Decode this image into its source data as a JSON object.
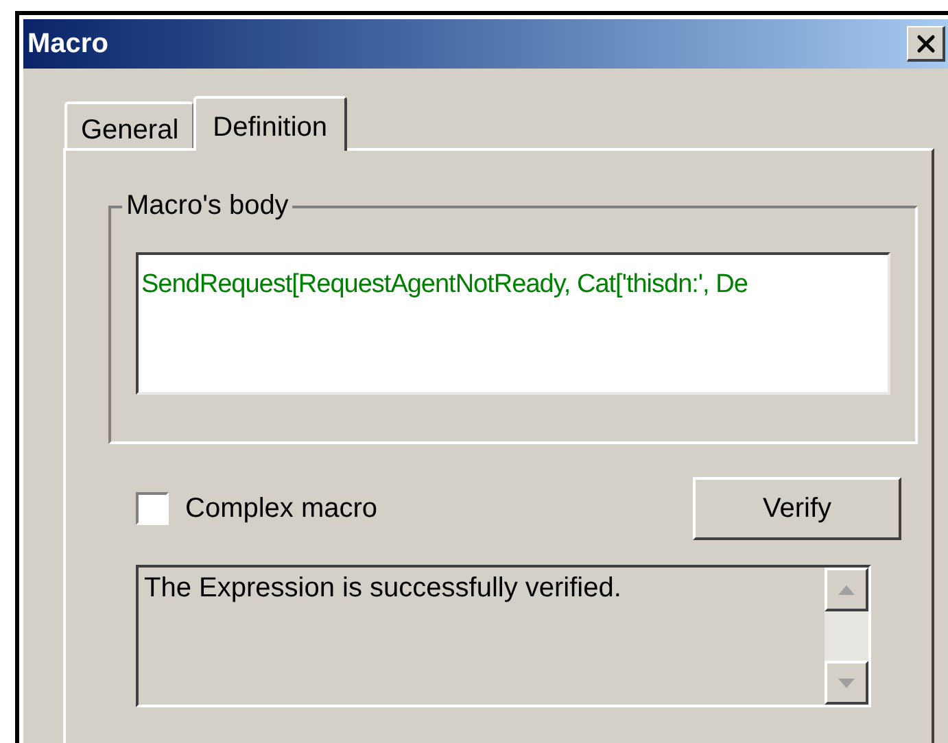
{
  "window": {
    "title": "Macro"
  },
  "tabs": [
    {
      "label": "General",
      "selected": false
    },
    {
      "label": "Definition",
      "selected": true
    }
  ],
  "body_group": {
    "label": "Macro's body",
    "value": "SendRequest[RequestAgentNotReady, Cat['thisdn:', De"
  },
  "complex_macro": {
    "label": "Complex macro",
    "checked": false
  },
  "verify_button": {
    "label": "Verify"
  },
  "message": {
    "text": "The Expression is successfully verified."
  }
}
